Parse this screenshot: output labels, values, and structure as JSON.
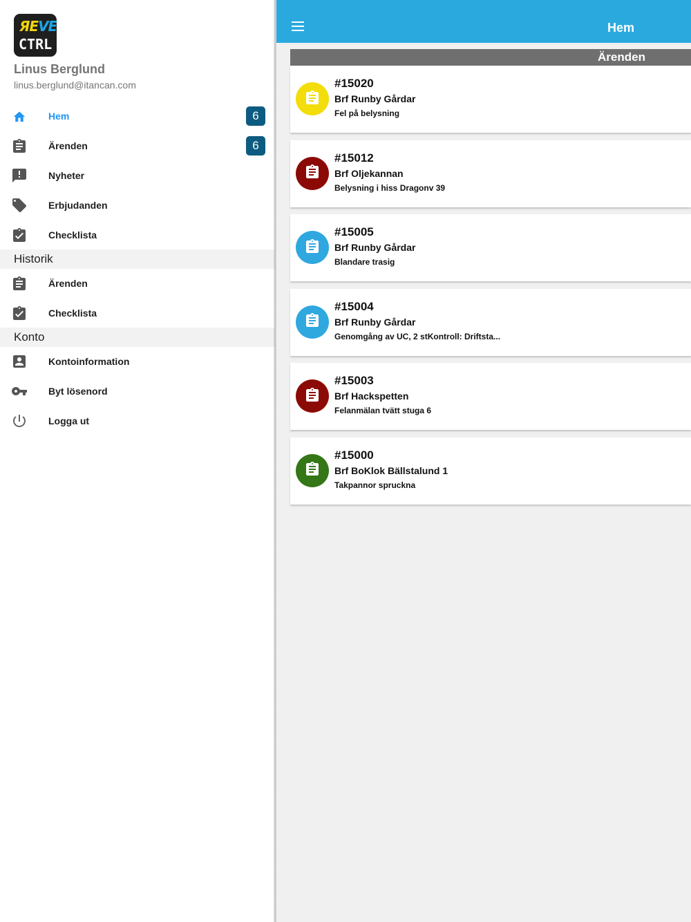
{
  "app": {
    "logo_top": "ЯEVE",
    "logo_bottom": "CTRL"
  },
  "user": {
    "name": "Linus Berglund",
    "email": "linus.berglund@itancan.com"
  },
  "nav": {
    "main_items": [
      {
        "label": "Hem",
        "icon": "home-icon",
        "badge": "6",
        "active": true
      },
      {
        "label": "Ärenden",
        "icon": "clipboard-icon",
        "badge": "6"
      },
      {
        "label": "Nyheter",
        "icon": "announcement-icon"
      },
      {
        "label": "Erbjudanden",
        "icon": "tag-icon"
      },
      {
        "label": "Checklista",
        "icon": "clipboard-check-icon"
      }
    ],
    "history_header": "Historik",
    "history_items": [
      {
        "label": "Ärenden",
        "icon": "clipboard-icon"
      },
      {
        "label": "Checklista",
        "icon": "clipboard-check-icon"
      }
    ],
    "account_header": "Konto",
    "account_items": [
      {
        "label": "Kontoinformation",
        "icon": "account-box-icon"
      },
      {
        "label": "Byt lösenord",
        "icon": "key-icon"
      },
      {
        "label": "Logga ut",
        "icon": "power-icon"
      }
    ]
  },
  "header": {
    "title": "Hem",
    "menu_icon": "hamburger-menu-icon"
  },
  "section": {
    "title": "Ärenden"
  },
  "cases": [
    {
      "number": "#15020",
      "title": "Brf Runby Gårdar",
      "description": "Fel på belysning",
      "color": "#f3dd0a"
    },
    {
      "number": "#15012",
      "title": "Brf Oljekannan",
      "description": "Belysning i hiss Dragonv 39",
      "color": "#8b0a06"
    },
    {
      "number": "#15005",
      "title": "Brf Runby Gårdar",
      "description": "Blandare trasig",
      "color": "#2fa8df"
    },
    {
      "number": "#15004",
      "title": "Brf Runby Gårdar",
      "description": "Genomgång av UC,  2 stKontroll: Driftsta...",
      "color": "#2fa8df"
    },
    {
      "number": "#15003",
      "title": "Brf Hackspetten",
      "description": "Felanmälan tvätt stuga 6",
      "color": "#8b0a06"
    },
    {
      "number": "#15000",
      "title": "Brf BoKlok Bällstalund 1",
      "description": "Takpannor spruckna",
      "color": "#347716"
    }
  ],
  "colors": {
    "accent": "#2aa9df",
    "active_nav": "#2196f3",
    "badge": "#0d5b80",
    "section_bar": "#6f6f6f"
  }
}
